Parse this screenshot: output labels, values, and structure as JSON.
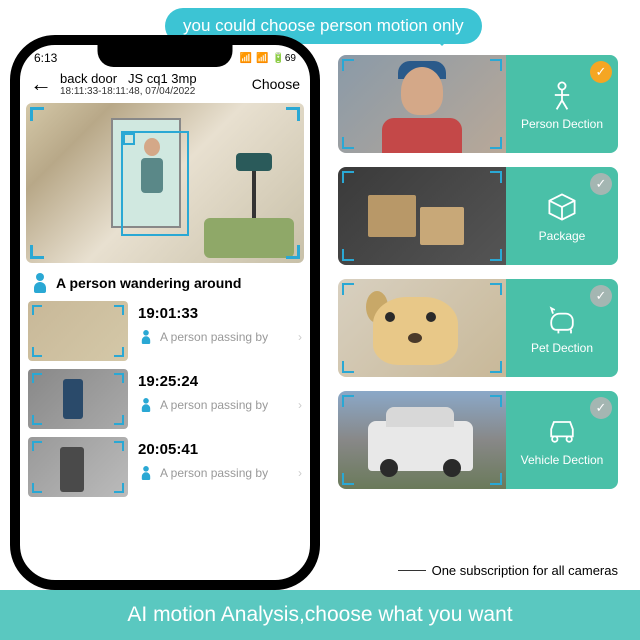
{
  "bubble_text": "you could choose person motion only",
  "phone": {
    "status_time": "6:13",
    "status_battery": "69",
    "header": {
      "title": "back door",
      "device": "JS cq1  3mp",
      "timestamp": "18:11:33-18:11:48, 07/04/2022",
      "choose": "Choose"
    },
    "alert": "A person wandering around",
    "events": [
      {
        "time": "19:01:33",
        "desc": "A person passing by"
      },
      {
        "time": "19:25:24",
        "desc": "A person passing by"
      },
      {
        "time": "20:05:41",
        "desc": "A person passing by"
      }
    ]
  },
  "tiles": [
    {
      "label": "Person Dection",
      "selected": true
    },
    {
      "label": "Package",
      "selected": false
    },
    {
      "label": "Pet Dection",
      "selected": false
    },
    {
      "label": "Vehicle Dection",
      "selected": false
    }
  ],
  "subscription_text": "One subscription for all cameras",
  "footer_text": "AI motion Analysis,choose what you want"
}
